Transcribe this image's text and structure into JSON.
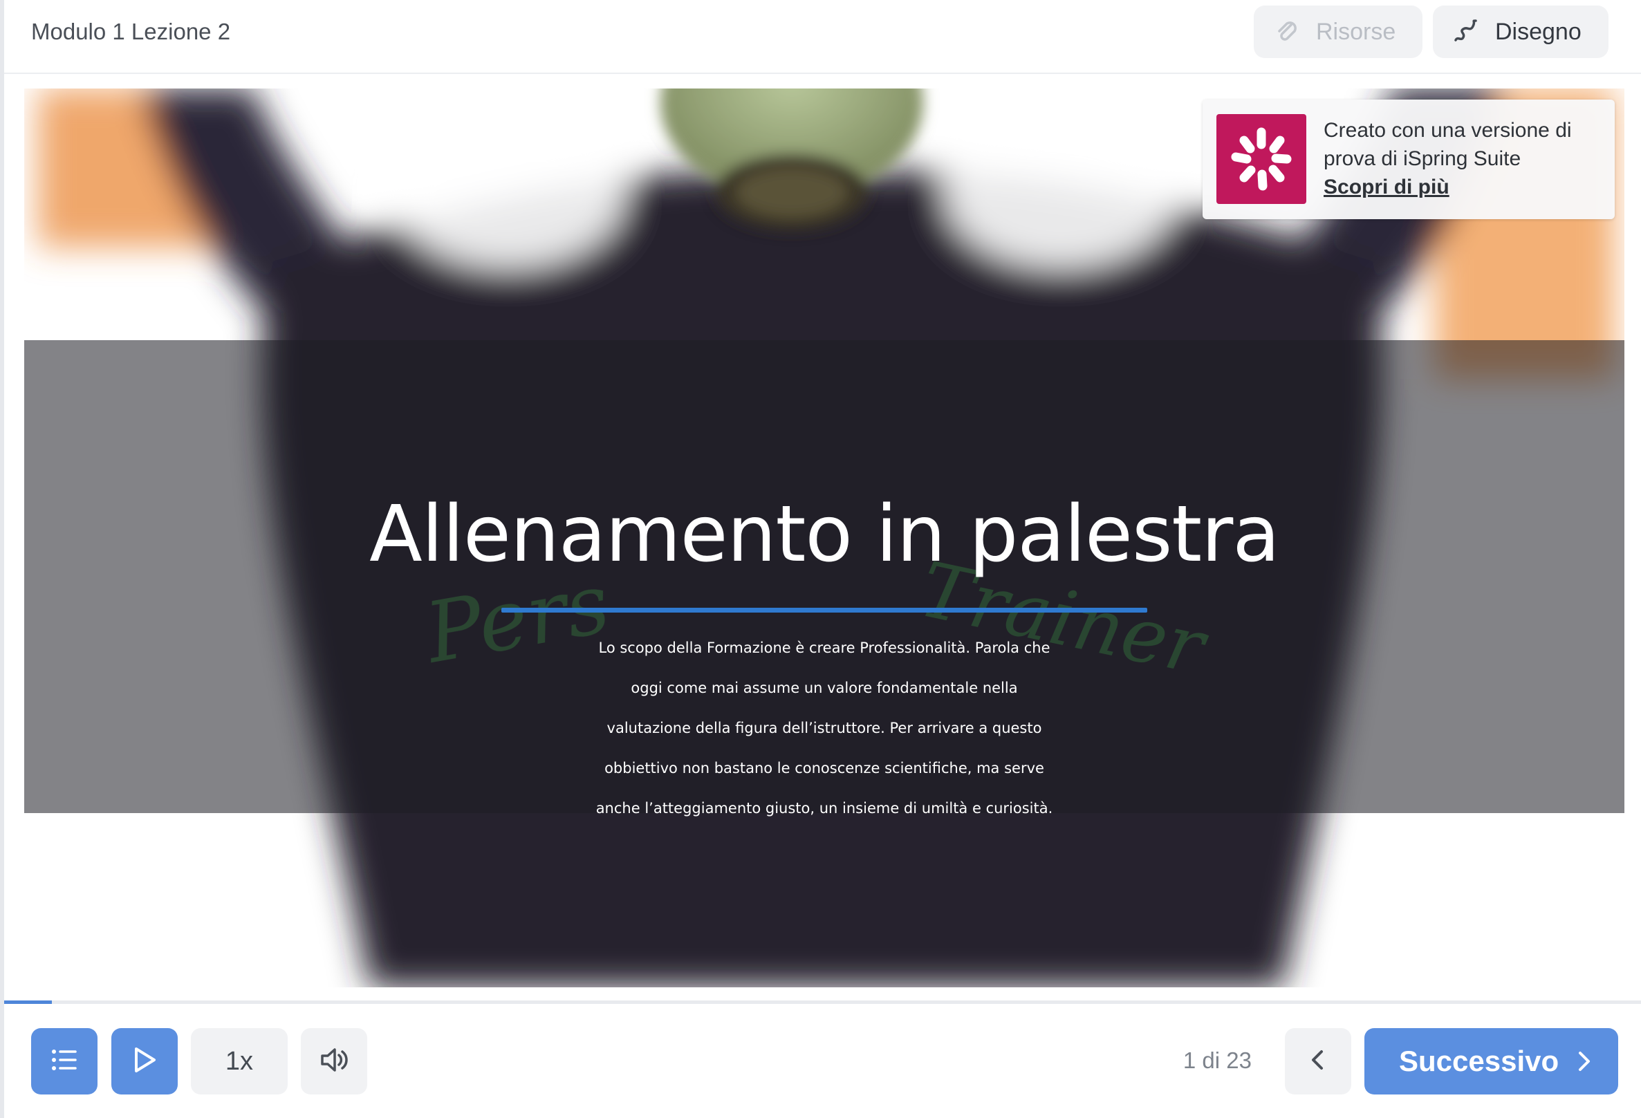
{
  "header": {
    "lesson_title": "Modulo 1 Lezione 2",
    "resources_label": "Risorse",
    "drawing_label": "Disegno"
  },
  "slide": {
    "title": "Allenamento in palestra",
    "body": "Lo scopo della Formazione è creare Professionalità. Parola che oggi come mai assume un valore fondamentale nella valutazione della figura dell’istruttore. Per arrivare a questo obbiettivo non bastano le conoscenze scientifiche, ma serve anche l’atteggiamento giusto, un insieme di umiltà e curiosità."
  },
  "banner": {
    "text": "Creato con una versione di prova di iSpring Suite",
    "link": "Scopri di più"
  },
  "progress": {
    "fraction": 0.029
  },
  "controls": {
    "speed_label": "1x",
    "slide_counter": "1 di 23",
    "next_label": "Successivo"
  },
  "colors": {
    "accent": "#5b8fe0",
    "title_rule": "#2f7ad0",
    "ispring_brand": "#c0185c"
  },
  "icons": {
    "resources": "paperclip-icon",
    "drawing": "pen-squiggle-icon",
    "menu": "list-icon",
    "play": "play-icon",
    "volume": "speaker-icon",
    "prev": "chevron-left-icon",
    "next": "chevron-right-icon",
    "banner_logo": "ispring-logo"
  }
}
